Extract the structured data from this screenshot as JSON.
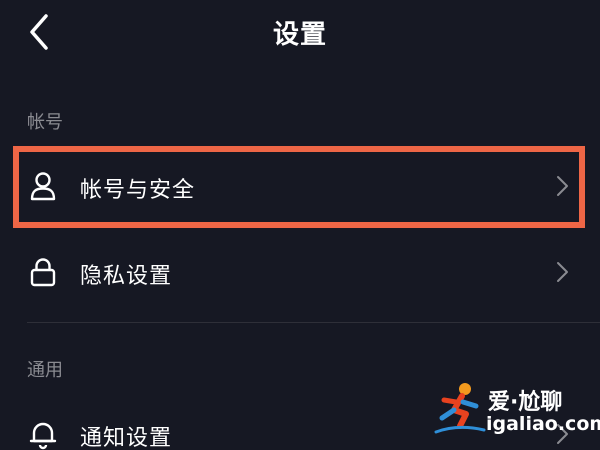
{
  "header": {
    "title": "设置",
    "back_icon": "chevron-left-icon"
  },
  "sections": [
    {
      "title": "帐号",
      "items": [
        {
          "label": "帐号与安全",
          "icon": "user-icon",
          "highlighted": true
        },
        {
          "label": "隐私设置",
          "icon": "lock-icon"
        }
      ]
    },
    {
      "title": "通用",
      "items": [
        {
          "label": "通知设置",
          "icon": "bell-icon"
        }
      ]
    }
  ],
  "watermark": {
    "title": "爱·尬聊",
    "url": "igaliao.com"
  },
  "colors": {
    "background": "#161823",
    "highlight_border": "#ee6646",
    "section_text": "#8a8b91",
    "chevron": "#8a8b91"
  }
}
